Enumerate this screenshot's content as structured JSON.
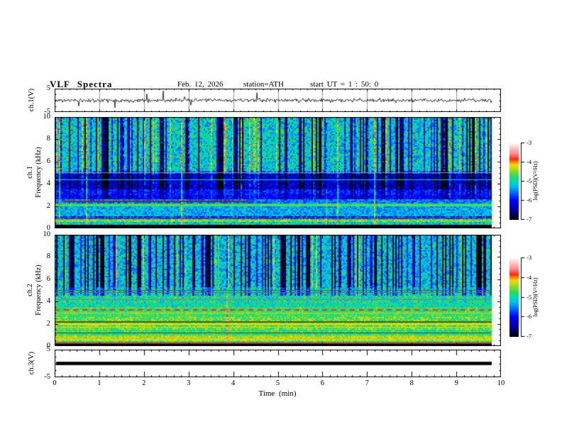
{
  "header": {
    "title": "VLF Spectra",
    "date": "Feb. 12, 2026",
    "station": "station=ATH",
    "start_ut": "start UT =  1 : 50: 0"
  },
  "chart_data": {
    "type": "multi-panel: line + spectrogram heatmaps",
    "title": "VLF Spectra",
    "date": "Feb. 12, 2026",
    "station": "ATH",
    "start_ut": "1 : 50: 0",
    "x": {
      "label": "Time  (min)",
      "range_min": [
        0,
        10
      ],
      "major_ticks": [
        0,
        1,
        2,
        3,
        4,
        5,
        6,
        7,
        8,
        9,
        10
      ],
      "minor_divisions": 6,
      "data_end_min": 9.79
    },
    "colorbar": {
      "label": "log(PSD)(V²/Hz)",
      "ticks": [
        -3,
        -4,
        -5,
        -6,
        -7
      ],
      "range": [
        -7,
        -3
      ],
      "stops": [
        [
          -7.0,
          "#000000"
        ],
        [
          -6.55,
          "#000090"
        ],
        [
          -6.0,
          "#0000ff"
        ],
        [
          -5.55,
          "#0078ff"
        ],
        [
          -5.25,
          "#00c0e8"
        ],
        [
          -5.0,
          "#00ddb0"
        ],
        [
          -4.75,
          "#2ada5a"
        ],
        [
          -4.5,
          "#7fd92e"
        ],
        [
          -4.3,
          "#c6dd14"
        ],
        [
          -4.15,
          "#f2d800"
        ],
        [
          -4.0,
          "#ff8400"
        ],
        [
          -3.85,
          "#ff2a16"
        ],
        [
          -3.55,
          "#ff8f8f"
        ],
        [
          -3.25,
          "#ffc9c9"
        ],
        [
          -3.0,
          "#ffffff"
        ]
      ]
    },
    "panels": [
      {
        "id": "ch1_waveform",
        "kind": "line",
        "ylabel": "ch.1(V)",
        "yrange": [
          -5,
          5
        ],
        "ytick_labels": [
          5,
          -5
        ],
        "description": "broadband noise around 0 V, ~±1 V, sparse spikes to ±4 V, minute gridlines",
        "signal": {
          "baseline": 0,
          "noise_sigma": 0.5,
          "spike_prob": 0.012,
          "spike_amp_max": 4.2,
          "seed": 11,
          "t_end_min": 9.79
        }
      },
      {
        "id": "ch1_spectrogram",
        "kind": "spectrogram",
        "ylabel_line1": "ch.1",
        "ylabel_line2": "Frequency  (kHz)",
        "yrange_khz": [
          0,
          10
        ],
        "yticks": [
          10,
          8,
          6,
          4,
          2,
          0
        ],
        "seed": 23,
        "column_streaks": {
          "dark_prob": 0.27,
          "dark_min": 0.7,
          "dark_max": 2.3,
          "bright_prob": 0.07,
          "bright_min": 0.45,
          "full_prob": 0.012
        },
        "bands": [
          {
            "f0": 5.2,
            "f1": 10.0,
            "v": -5.15,
            "noise": 0.5,
            "st": 1.0
          },
          {
            "f0": 4.95,
            "f1": 5.2,
            "v": -5.6,
            "noise": 0.35,
            "st": 0.8
          },
          {
            "f0": 3.55,
            "f1": 4.95,
            "v": -6.25,
            "noise": 0.4,
            "st": 0.55
          },
          {
            "f0": 3.05,
            "f1": 3.55,
            "v": -5.9,
            "noise": 0.3,
            "st": 0.3
          },
          {
            "f0": 2.6,
            "f1": 3.05,
            "v": -6.05,
            "noise": 0.3,
            "st": 0.25
          },
          {
            "f0": 2.25,
            "f1": 2.6,
            "v": -5.55,
            "noise": 0.35
          },
          {
            "f0": 2.0,
            "f1": 2.25,
            "v": -4.8,
            "noise": 0.3
          },
          {
            "f0": 1.05,
            "f1": 2.0,
            "v": -5.35,
            "noise": 0.35
          },
          {
            "f0": 0.85,
            "f1": 1.05,
            "v": -5.95,
            "noise": 0.5
          },
          {
            "f0": 0.6,
            "f1": 0.85,
            "v": -4.55,
            "noise": 0.35
          },
          {
            "f0": 0.28,
            "f1": 0.6,
            "v": -5.1,
            "noise": 0.5
          },
          {
            "f0": 0.0,
            "f1": 0.28,
            "v": -7.0,
            "noise": 0.06
          }
        ],
        "lines": [
          {
            "f": 5.02,
            "color": "#8e8ea0",
            "w": 1
          },
          {
            "f": 4.4,
            "v": -5.0,
            "w": 1
          },
          {
            "f": 2.5,
            "color": "#6e3526",
            "w": 2,
            "t0": 0.2,
            "t1": 4.3
          },
          {
            "f": 2.1,
            "v": -4.55,
            "w": 1
          },
          {
            "f": 0.95,
            "color": "#6f6a85",
            "w": 1
          }
        ]
      },
      {
        "id": "ch2_spectrogram",
        "kind": "spectrogram",
        "ylabel_line1": "ch.2",
        "ylabel_line2": "Frequency  (kHz)",
        "yrange_khz": [
          0,
          10
        ],
        "yticks": [
          10,
          8,
          6,
          4,
          2,
          0
        ],
        "seed": 57,
        "column_streaks": {
          "dark_prob": 0.33,
          "dark_min": 0.8,
          "dark_max": 2.4,
          "bright_prob": 0.06,
          "bright_min": 0.4,
          "full_prob": 0.013
        },
        "bands": [
          {
            "f0": 5.3,
            "f1": 10.0,
            "v": -5.25,
            "noise": 0.45,
            "st": 1.0
          },
          {
            "f0": 4.55,
            "f1": 5.3,
            "v": -5.1,
            "noise": 0.5,
            "st": 0.5
          },
          {
            "f0": 3.9,
            "f1": 4.55,
            "v": -4.95,
            "noise": 0.45
          },
          {
            "f0": 3.45,
            "f1": 3.9,
            "v": -5.0,
            "noise": 0.4
          },
          {
            "f0": 2.6,
            "f1": 3.45,
            "v": -4.75,
            "noise": 0.35
          },
          {
            "f0": 1.45,
            "f1": 2.6,
            "v": -4.6,
            "noise": 0.4
          },
          {
            "f0": 0.9,
            "f1": 1.45,
            "v": -4.8,
            "noise": 0.4
          },
          {
            "f0": 0.5,
            "f1": 0.9,
            "v": -4.35,
            "noise": 0.3
          },
          {
            "f0": 0.28,
            "f1": 0.5,
            "v": -4.9,
            "noise": 0.45
          },
          {
            "f0": 0.0,
            "f1": 0.28,
            "v": -7.0,
            "noise": 0.06
          }
        ],
        "lines": [
          {
            "f": 5.05,
            "color": "#5a6050",
            "w": 1
          },
          {
            "f": 4.85,
            "color": "#6a7058",
            "w": 1
          },
          {
            "f": 4.2,
            "color": "#7a8288",
            "w": 1
          },
          {
            "f": 3.3,
            "v": -3.85,
            "w": 2,
            "dash": [
              7,
              6
            ]
          },
          {
            "f": 3.0,
            "v": -4.3,
            "w": 1
          },
          {
            "f": 2.2,
            "color": "#4f5c20",
            "w": 2
          },
          {
            "f": 2.05,
            "v": -4.15,
            "w": 2
          },
          {
            "f": 1.75,
            "v": -4.3,
            "w": 1
          },
          {
            "f": 1.2,
            "color": "#44511f",
            "w": 1
          },
          {
            "f": 0.65,
            "v": -4.2,
            "w": 1
          },
          {
            "f": 0.33,
            "color": "#a33220",
            "w": 2
          }
        ]
      },
      {
        "id": "ch3_waveform",
        "kind": "line",
        "ylabel": "ch.3(V)",
        "yrange": [
          -5,
          5
        ],
        "ytick_labels": [
          5,
          -5
        ],
        "description": "flat saturated trace at 0 V (thick black line) ending near 9.79 min",
        "signal": {
          "flat_value": 0,
          "thickness_v": 1.2,
          "t_end_min": 9.79
        }
      }
    ]
  }
}
